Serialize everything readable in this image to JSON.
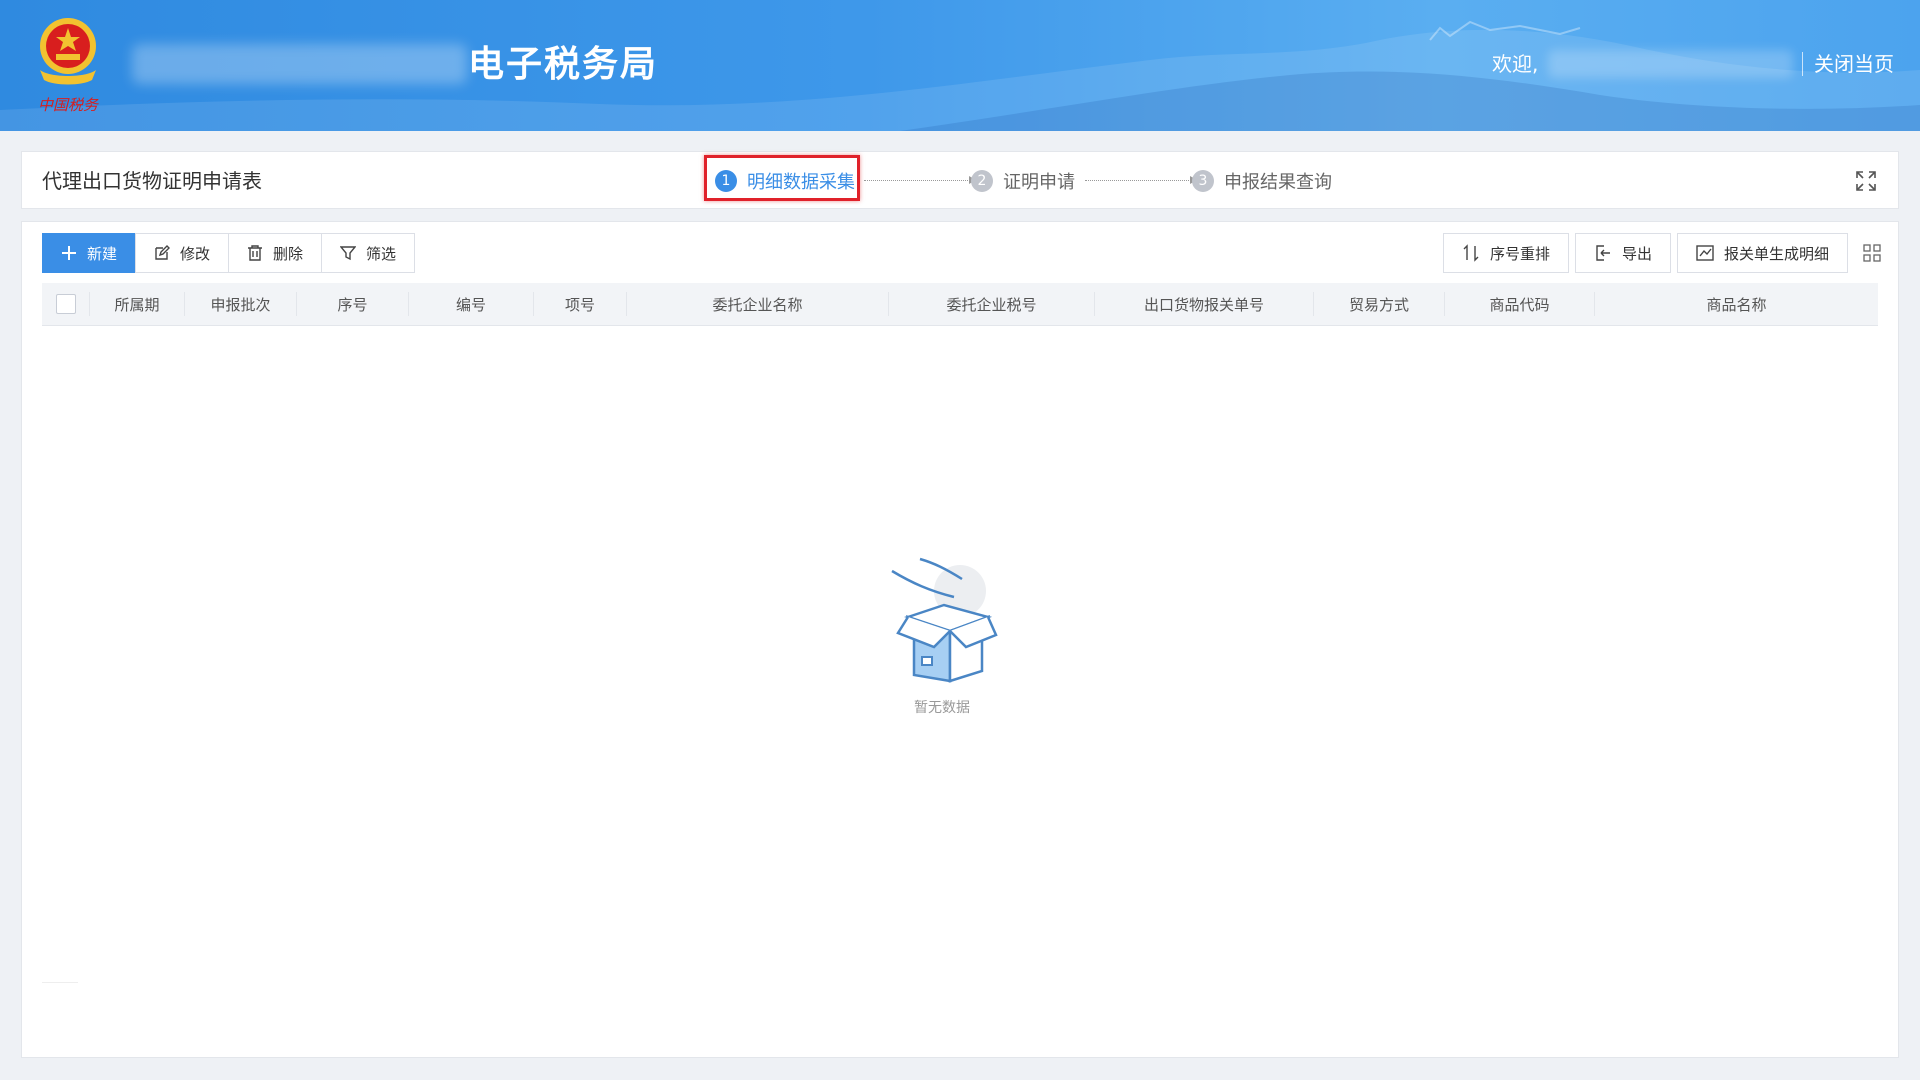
{
  "header": {
    "title": "电子税务局",
    "welcome": "欢迎,",
    "close_page": "关闭当页",
    "emblem_text": "中国税务"
  },
  "steps_bar": {
    "form_title": "代理出口货物证明申请表",
    "steps": [
      {
        "number": "1",
        "label": "明细数据采集",
        "active": true
      },
      {
        "number": "2",
        "label": "证明申请",
        "active": false
      },
      {
        "number": "3",
        "label": "申报结果查询",
        "active": false
      }
    ]
  },
  "toolbar": {
    "new": "新建",
    "edit": "修改",
    "delete": "删除",
    "filter": "筛选",
    "reorder": "序号重排",
    "export": "导出",
    "generate": "报关单生成明细"
  },
  "table": {
    "columns": [
      "所属期",
      "申报批次",
      "序号",
      "编号",
      "项号",
      "委托企业名称",
      "委托企业税号",
      "出口货物报关单号",
      "贸易方式",
      "商品代码",
      "商品名称"
    ],
    "empty_text": "暂无数据"
  },
  "colors": {
    "primary": "#3a8ee6",
    "highlight": "#e0212a",
    "header_blue": "#3e98ea"
  }
}
